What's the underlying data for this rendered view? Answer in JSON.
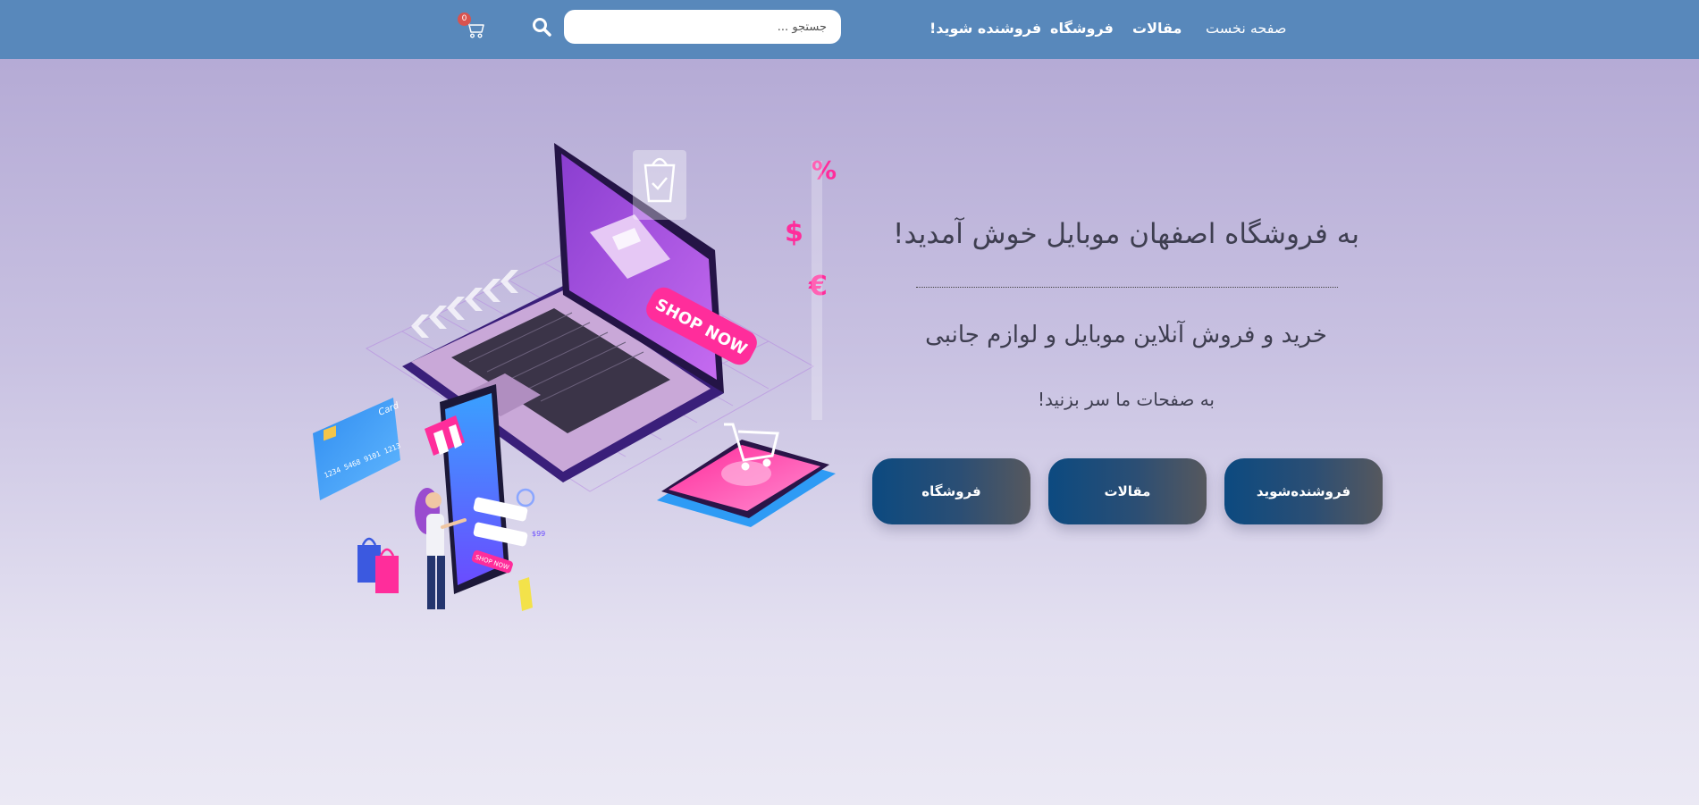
{
  "nav": {
    "items": [
      {
        "label": "صفحه نخست"
      },
      {
        "label": "مقالات"
      },
      {
        "label": "فروشگاه"
      },
      {
        "label": "فروشنده شوید!"
      }
    ],
    "search": {
      "placeholder": "جستجو ..."
    },
    "search_icon": "search-icon",
    "cart_icon": "cart-icon",
    "cart_count": "0"
  },
  "hero": {
    "title": "به فروشگاه اصفهان موبایل خوش آمدید!",
    "subtitle": "خرید و فروش آنلاین موبایل و لوازم جانبی",
    "text": "به صفحات ما سر بزنید!",
    "buttons": [
      {
        "label": "فروشنده‌شوید"
      },
      {
        "label": "مقالات"
      },
      {
        "label": "فروشگاه"
      }
    ]
  },
  "illustration": {
    "shop_now_label": "SHOP NOW",
    "card_label": "Card",
    "card_number": "1234 5468 9101 1213",
    "price_label": "$99",
    "phone_shop_now": "SHOP NOW",
    "symbols": [
      "%",
      "$",
      "€"
    ]
  },
  "colors": {
    "topbar": "#5888bb",
    "button_gradient_start": "#0c4a80",
    "button_gradient_end": "#56585e",
    "accent_pink": "#ff2d9b"
  }
}
